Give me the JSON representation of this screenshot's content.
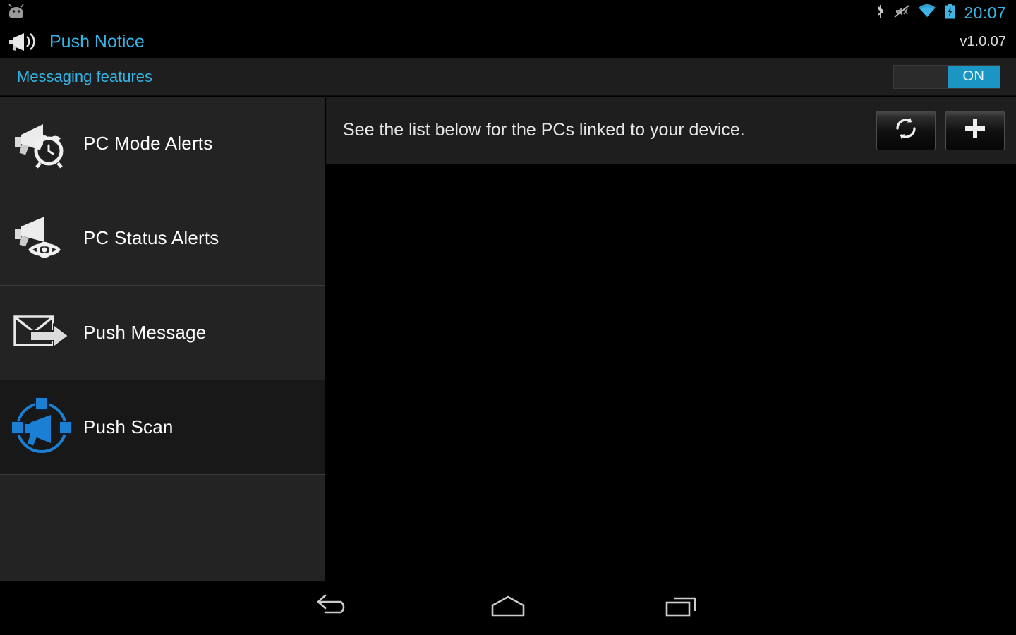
{
  "statusbar": {
    "os_icon": "android-head-icon",
    "icons": [
      "bluetooth-icon",
      "ringer-muted-icon",
      "wifi-icon",
      "battery-charging-icon"
    ],
    "clock": "20:07",
    "clock_color": "#33b5e5"
  },
  "titlebar": {
    "icon": "megaphone-icon",
    "title": "Push Notice",
    "title_color": "#33b5e5",
    "version": "v1.0.07"
  },
  "featurebar": {
    "title": "Messaging features",
    "title_color": "#33b5e5",
    "toggle": {
      "state": "on",
      "on_label": "ON",
      "on_color": "#1b95c4"
    }
  },
  "sidebar": {
    "items": [
      {
        "label": "PC Mode Alerts",
        "icon": "megaphone-clock-icon",
        "active": false
      },
      {
        "label": "PC Status Alerts",
        "icon": "megaphone-eye-icon",
        "active": false
      },
      {
        "label": "Push Message",
        "icon": "envelope-arrow-icon",
        "active": false
      },
      {
        "label": "Push Scan",
        "icon": "megaphone-scan-icon",
        "active": true
      }
    ],
    "active_icon_color": "#1b7fd4"
  },
  "content": {
    "header_text": "See the list below for the PCs linked to your device.",
    "actions": [
      {
        "name": "refresh-button",
        "icon": "refresh-icon"
      },
      {
        "name": "add-button",
        "icon": "plus-icon"
      }
    ],
    "list_items": []
  },
  "navbar": {
    "buttons": [
      {
        "name": "back-button",
        "icon": "back-arrow-icon"
      },
      {
        "name": "home-button",
        "icon": "home-icon"
      },
      {
        "name": "recents-button",
        "icon": "recents-icon"
      }
    ]
  }
}
